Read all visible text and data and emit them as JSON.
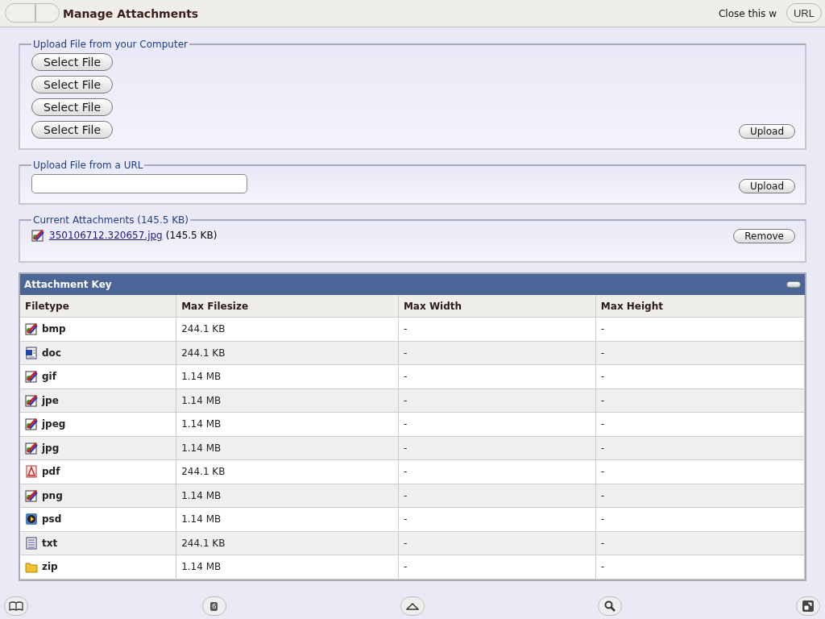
{
  "header": {
    "title": "Manage Attachments",
    "close_link": "Close this w"
  },
  "browser_controls": {
    "url_button": "URL",
    "tabs_count": "6"
  },
  "upload_computer": {
    "legend": "Upload File from your Computer",
    "select_buttons": [
      "Select File",
      "Select File",
      "Select File",
      "Select File"
    ],
    "upload_button": "Upload"
  },
  "upload_url": {
    "legend": "Upload File from a URL",
    "upload_button": "Upload"
  },
  "current_attachments": {
    "legend": "Current Attachments (145.5 KB)",
    "files": [
      {
        "name": "350106712.320657.jpg",
        "size": "(145.5 KB)",
        "kind": "image"
      }
    ],
    "remove_button": "Remove"
  },
  "attachment_key": {
    "title": "Attachment Key",
    "collapsed": false,
    "columns": [
      "Filetype",
      "Max Filesize",
      "Max Width",
      "Max Height"
    ],
    "rows": [
      {
        "kind": "image",
        "cells": [
          "bmp",
          "244.1 KB",
          "-",
          "-"
        ]
      },
      {
        "kind": "word",
        "cells": [
          "doc",
          "244.1 KB",
          "-",
          "-"
        ]
      },
      {
        "kind": "image",
        "cells": [
          "gif",
          "1.14 MB",
          "-",
          "-"
        ]
      },
      {
        "kind": "image",
        "cells": [
          "jpe",
          "1.14 MB",
          "-",
          "-"
        ]
      },
      {
        "kind": "image",
        "cells": [
          "jpeg",
          "1.14 MB",
          "-",
          "-"
        ]
      },
      {
        "kind": "image",
        "cells": [
          "jpg",
          "1.14 MB",
          "-",
          "-"
        ]
      },
      {
        "kind": "pdf",
        "cells": [
          "pdf",
          "244.1 KB",
          "-",
          "-"
        ]
      },
      {
        "kind": "image",
        "cells": [
          "png",
          "1.14 MB",
          "-",
          "-"
        ]
      },
      {
        "kind": "media",
        "cells": [
          "psd",
          "1.14 MB",
          "-",
          "-"
        ]
      },
      {
        "kind": "text",
        "cells": [
          "txt",
          "244.1 KB",
          "-",
          "-"
        ]
      },
      {
        "kind": "folder",
        "cells": [
          "zip",
          "1.14 MB",
          "-",
          "-"
        ]
      }
    ]
  }
}
